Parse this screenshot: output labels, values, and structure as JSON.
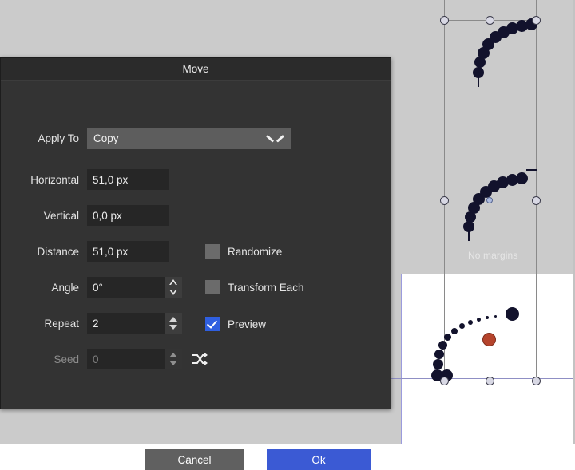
{
  "canvas": {
    "background_color": "#cbcbcb",
    "page_color": "#ffffff",
    "guide_color": "#8f8fc4",
    "no_margins_label": "No margins",
    "dot_color": "#12122c",
    "accent_dot_color": "#b5442c"
  },
  "dialog": {
    "title": "Move",
    "apply_to": {
      "label": "Apply To",
      "value": "Copy",
      "icon": "chevron-down-icon"
    },
    "fields": [
      {
        "label": "Horizontal",
        "value": "51,0 px",
        "spinner": false,
        "disabled": false
      },
      {
        "label": "Vertical",
        "value": "0,0 px",
        "spinner": false,
        "disabled": false
      },
      {
        "label": "Distance",
        "value": "51,0 px",
        "spinner": false,
        "disabled": false
      },
      {
        "label": "Angle",
        "value": "0°",
        "spinner": true,
        "disabled": false
      },
      {
        "label": "Repeat",
        "value": "2",
        "spinner": true,
        "disabled": false
      },
      {
        "label": "Seed",
        "value": "0",
        "spinner": true,
        "disabled": true
      }
    ],
    "checkboxes": [
      {
        "label": "Randomize",
        "checked": false
      },
      {
        "label": "Transform Each",
        "checked": false
      },
      {
        "label": "Preview",
        "checked": true
      }
    ],
    "shuffle_icon": "shuffle-icon",
    "buttons": {
      "cancel": "Cancel",
      "ok": "Ok"
    },
    "accent_color": "#3b5ad4",
    "background_color": "#333333"
  }
}
